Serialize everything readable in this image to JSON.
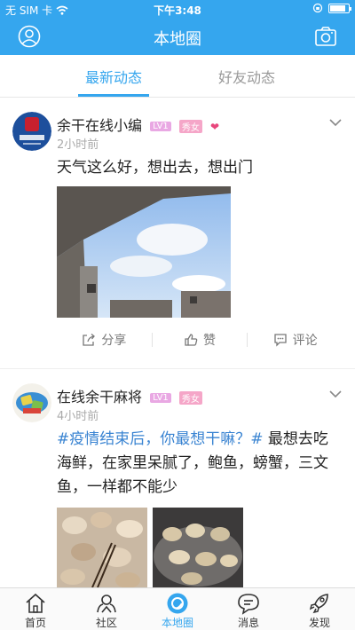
{
  "status_bar": {
    "carrier": "无 SIM 卡",
    "time": "下午3:48",
    "battery_level": 0.85
  },
  "nav": {
    "title": "本地圈"
  },
  "tabs": [
    {
      "label": "最新动态",
      "active": true
    },
    {
      "label": "好友动态",
      "active": false
    }
  ],
  "posts": [
    {
      "username": "余干在线小编",
      "level": "LV1",
      "gender": "秀女",
      "time": "2小时前",
      "content": "天气这么好，想出去，想出门",
      "actions": {
        "share": "分享",
        "like": "赞",
        "comment": "评论"
      }
    },
    {
      "username": "在线余干麻将",
      "level": "LV1",
      "gender": "秀女",
      "time": "4小时前",
      "topic": "#疫情结束后，你最想干嘛？#",
      "content": " 最想去吃海鲜，在家里呆腻了，鲍鱼，螃蟹，三文鱼，一样都不能少"
    }
  ],
  "tabbar": [
    {
      "label": "首页",
      "icon": "home-icon"
    },
    {
      "label": "社区",
      "icon": "community-icon"
    },
    {
      "label": "本地圈",
      "icon": "local-circle-icon",
      "active": true
    },
    {
      "label": "消息",
      "icon": "message-icon"
    },
    {
      "label": "发现",
      "icon": "discover-icon"
    }
  ],
  "colors": {
    "accent": "#35a6ee",
    "topic": "#3a84d2",
    "level_badge": "#e9a8e3",
    "gender_badge": "#f5a6c8"
  }
}
